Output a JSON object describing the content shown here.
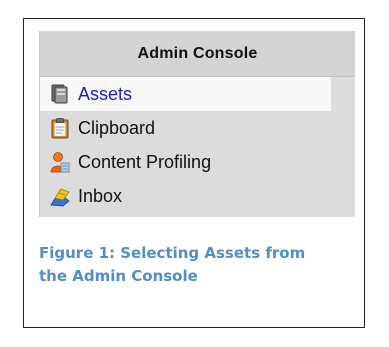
{
  "console": {
    "title": "Admin Console",
    "items": [
      {
        "label": "Assets",
        "icon": "assets-icon",
        "selected": true
      },
      {
        "label": "Clipboard",
        "icon": "clipboard-icon",
        "selected": false
      },
      {
        "label": "Content Profiling",
        "icon": "content-profiling-icon",
        "selected": false
      },
      {
        "label": "Inbox",
        "icon": "inbox-icon",
        "selected": false
      }
    ]
  },
  "caption": {
    "line1": "Figure 1: Selecting Assets from",
    "line2": "the Admin Console"
  },
  "colors": {
    "caption": "#4f8ec9",
    "selected_text": "#1c1ccf",
    "panel_bg": "#dcdcdc"
  }
}
